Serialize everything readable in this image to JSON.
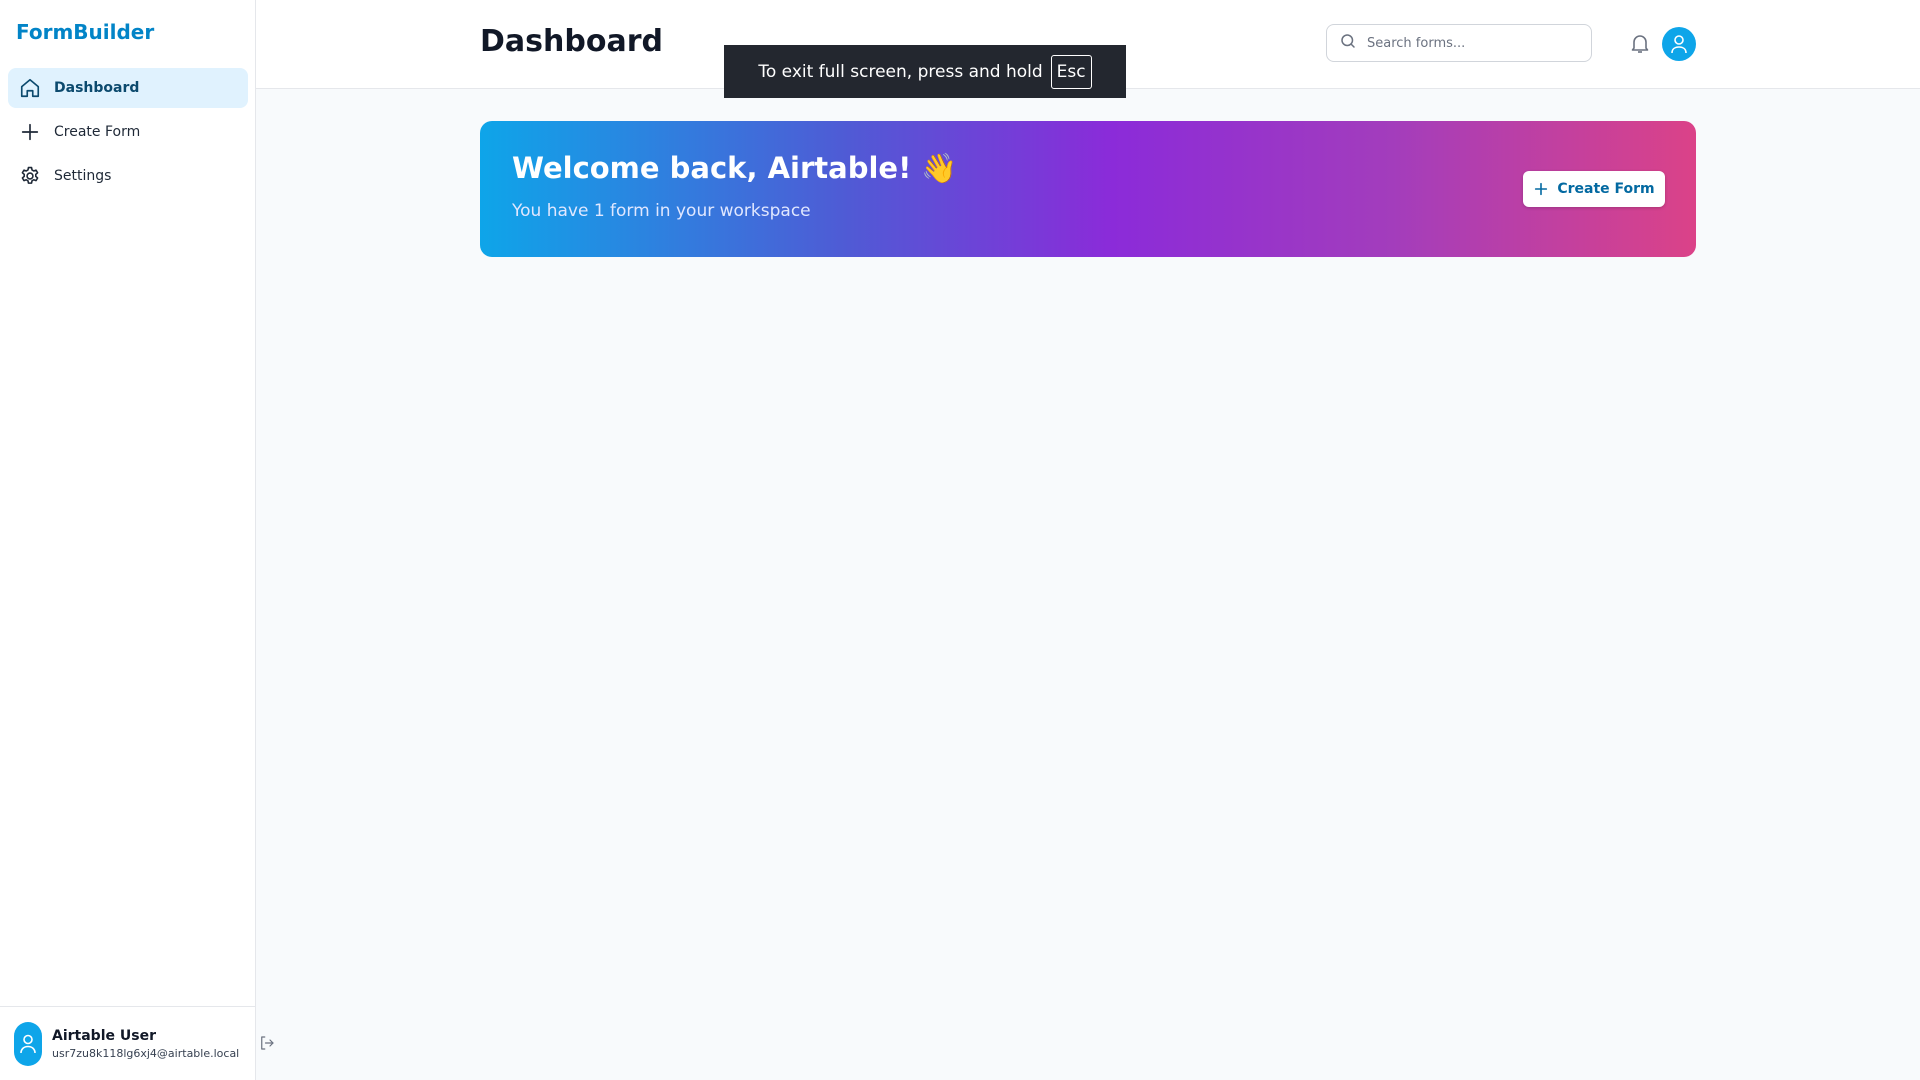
{
  "app": {
    "brand": "FormBuilder"
  },
  "sidebar": {
    "items": [
      {
        "label": "Dashboard",
        "icon": "home-icon",
        "active": true
      },
      {
        "label": "Create Form",
        "icon": "plus-icon",
        "active": false
      },
      {
        "label": "Settings",
        "icon": "gear-icon",
        "active": false
      }
    ]
  },
  "user": {
    "name": "Airtable User",
    "email": "usr7zu8k118lg6xj4@airtable.local"
  },
  "header": {
    "title": "Dashboard",
    "search_placeholder": "Search forms..."
  },
  "fullscreen_notice": {
    "text": "To exit full screen, press and hold",
    "key": "Esc"
  },
  "hero": {
    "title": "Welcome back, Airtable! 👋",
    "subtitle": "You have 1 form in your workspace",
    "button_label": "Create Form"
  },
  "colors": {
    "brand": "#0284c7",
    "accent": "#0ea5e9",
    "gradient_start": "#0ea5e9",
    "gradient_mid": "#8b2bd9",
    "gradient_end": "#db4288"
  }
}
